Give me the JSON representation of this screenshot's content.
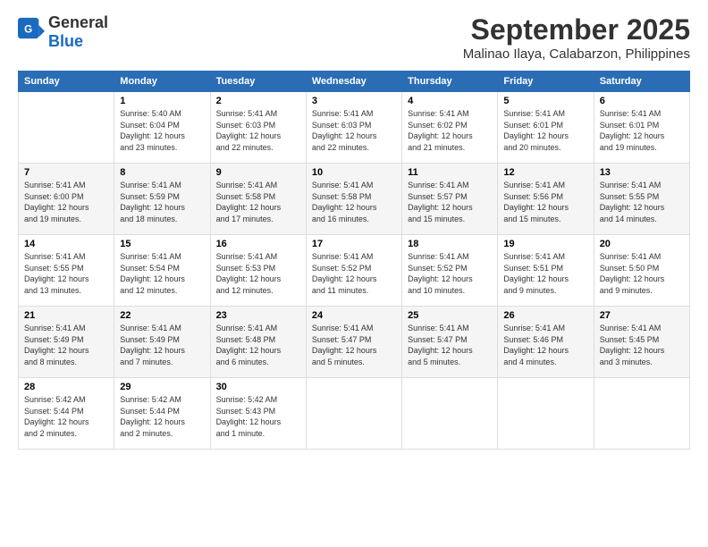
{
  "logo": {
    "line1": "General",
    "line2": "Blue"
  },
  "title": "September 2025",
  "location": "Malinao Ilaya, Calabarzon, Philippines",
  "days_of_week": [
    "Sunday",
    "Monday",
    "Tuesday",
    "Wednesday",
    "Thursday",
    "Friday",
    "Saturday"
  ],
  "weeks": [
    [
      {
        "day": "",
        "detail": ""
      },
      {
        "day": "1",
        "detail": "Sunrise: 5:40 AM\nSunset: 6:04 PM\nDaylight: 12 hours\nand 23 minutes."
      },
      {
        "day": "2",
        "detail": "Sunrise: 5:41 AM\nSunset: 6:03 PM\nDaylight: 12 hours\nand 22 minutes."
      },
      {
        "day": "3",
        "detail": "Sunrise: 5:41 AM\nSunset: 6:03 PM\nDaylight: 12 hours\nand 22 minutes."
      },
      {
        "day": "4",
        "detail": "Sunrise: 5:41 AM\nSunset: 6:02 PM\nDaylight: 12 hours\nand 21 minutes."
      },
      {
        "day": "5",
        "detail": "Sunrise: 5:41 AM\nSunset: 6:01 PM\nDaylight: 12 hours\nand 20 minutes."
      },
      {
        "day": "6",
        "detail": "Sunrise: 5:41 AM\nSunset: 6:01 PM\nDaylight: 12 hours\nand 19 minutes."
      }
    ],
    [
      {
        "day": "7",
        "detail": "Sunrise: 5:41 AM\nSunset: 6:00 PM\nDaylight: 12 hours\nand 19 minutes."
      },
      {
        "day": "8",
        "detail": "Sunrise: 5:41 AM\nSunset: 5:59 PM\nDaylight: 12 hours\nand 18 minutes."
      },
      {
        "day": "9",
        "detail": "Sunrise: 5:41 AM\nSunset: 5:58 PM\nDaylight: 12 hours\nand 17 minutes."
      },
      {
        "day": "10",
        "detail": "Sunrise: 5:41 AM\nSunset: 5:58 PM\nDaylight: 12 hours\nand 16 minutes."
      },
      {
        "day": "11",
        "detail": "Sunrise: 5:41 AM\nSunset: 5:57 PM\nDaylight: 12 hours\nand 15 minutes."
      },
      {
        "day": "12",
        "detail": "Sunrise: 5:41 AM\nSunset: 5:56 PM\nDaylight: 12 hours\nand 15 minutes."
      },
      {
        "day": "13",
        "detail": "Sunrise: 5:41 AM\nSunset: 5:55 PM\nDaylight: 12 hours\nand 14 minutes."
      }
    ],
    [
      {
        "day": "14",
        "detail": "Sunrise: 5:41 AM\nSunset: 5:55 PM\nDaylight: 12 hours\nand 13 minutes."
      },
      {
        "day": "15",
        "detail": "Sunrise: 5:41 AM\nSunset: 5:54 PM\nDaylight: 12 hours\nand 12 minutes."
      },
      {
        "day": "16",
        "detail": "Sunrise: 5:41 AM\nSunset: 5:53 PM\nDaylight: 12 hours\nand 12 minutes."
      },
      {
        "day": "17",
        "detail": "Sunrise: 5:41 AM\nSunset: 5:52 PM\nDaylight: 12 hours\nand 11 minutes."
      },
      {
        "day": "18",
        "detail": "Sunrise: 5:41 AM\nSunset: 5:52 PM\nDaylight: 12 hours\nand 10 minutes."
      },
      {
        "day": "19",
        "detail": "Sunrise: 5:41 AM\nSunset: 5:51 PM\nDaylight: 12 hours\nand 9 minutes."
      },
      {
        "day": "20",
        "detail": "Sunrise: 5:41 AM\nSunset: 5:50 PM\nDaylight: 12 hours\nand 9 minutes."
      }
    ],
    [
      {
        "day": "21",
        "detail": "Sunrise: 5:41 AM\nSunset: 5:49 PM\nDaylight: 12 hours\nand 8 minutes."
      },
      {
        "day": "22",
        "detail": "Sunrise: 5:41 AM\nSunset: 5:49 PM\nDaylight: 12 hours\nand 7 minutes."
      },
      {
        "day": "23",
        "detail": "Sunrise: 5:41 AM\nSunset: 5:48 PM\nDaylight: 12 hours\nand 6 minutes."
      },
      {
        "day": "24",
        "detail": "Sunrise: 5:41 AM\nSunset: 5:47 PM\nDaylight: 12 hours\nand 5 minutes."
      },
      {
        "day": "25",
        "detail": "Sunrise: 5:41 AM\nSunset: 5:47 PM\nDaylight: 12 hours\nand 5 minutes."
      },
      {
        "day": "26",
        "detail": "Sunrise: 5:41 AM\nSunset: 5:46 PM\nDaylight: 12 hours\nand 4 minutes."
      },
      {
        "day": "27",
        "detail": "Sunrise: 5:41 AM\nSunset: 5:45 PM\nDaylight: 12 hours\nand 3 minutes."
      }
    ],
    [
      {
        "day": "28",
        "detail": "Sunrise: 5:42 AM\nSunset: 5:44 PM\nDaylight: 12 hours\nand 2 minutes."
      },
      {
        "day": "29",
        "detail": "Sunrise: 5:42 AM\nSunset: 5:44 PM\nDaylight: 12 hours\nand 2 minutes."
      },
      {
        "day": "30",
        "detail": "Sunrise: 5:42 AM\nSunset: 5:43 PM\nDaylight: 12 hours\nand 1 minute."
      },
      {
        "day": "",
        "detail": ""
      },
      {
        "day": "",
        "detail": ""
      },
      {
        "day": "",
        "detail": ""
      },
      {
        "day": "",
        "detail": ""
      }
    ]
  ]
}
